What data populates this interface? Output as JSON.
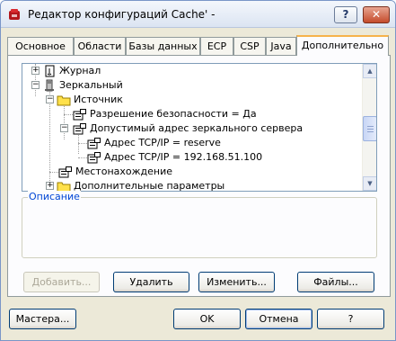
{
  "window": {
    "title": "Редактор конфигураций Cache' -",
    "help_label": "?",
    "close_label": "✕"
  },
  "tabs": [
    {
      "label": "Основное",
      "active": false
    },
    {
      "label": "Области",
      "active": false
    },
    {
      "label": "Базы данных",
      "active": false
    },
    {
      "label": "ECP",
      "active": false
    },
    {
      "label": "CSP",
      "active": false
    },
    {
      "label": "Java",
      "active": false
    },
    {
      "label": "Дополнительно",
      "active": true
    }
  ],
  "tree": {
    "items": [
      {
        "label": "Журнал",
        "icon": "journal-icon",
        "expander": "+"
      },
      {
        "label": "Зеркальный",
        "icon": "mirror-icon",
        "expander": "−"
      },
      {
        "label": "Источник",
        "icon": "folder-icon",
        "expander": "−"
      },
      {
        "label": "Разрешение безопасности = Да",
        "icon": "property-icon",
        "expander": ""
      },
      {
        "label": "Допустимый адрес зеркального сервера",
        "icon": "property-icon",
        "expander": "−"
      },
      {
        "label": "Адрес TCP/IP = reserve",
        "icon": "property-icon",
        "expander": ""
      },
      {
        "label": "Адрес TCP/IP = 192.168.51.100",
        "icon": "property-icon",
        "expander": ""
      },
      {
        "label": "Местонахождение",
        "icon": "property-icon",
        "expander": ""
      },
      {
        "label": "Дополнительные параметры",
        "icon": "folder-icon",
        "expander": "+"
      }
    ],
    "scroll_up": "▲",
    "scroll_down": "▼"
  },
  "description": {
    "label": "Описание"
  },
  "actions": {
    "add": "Добавить...",
    "delete": "Удалить",
    "edit": "Изменить...",
    "files": "Файлы..."
  },
  "footer": {
    "wizard": "Мастера...",
    "ok": "OK",
    "cancel": "Отмена",
    "help": "?"
  },
  "colors": {
    "accent": "#f6b34b",
    "folder": "#ffe14b",
    "title_link": "#0046d5"
  }
}
